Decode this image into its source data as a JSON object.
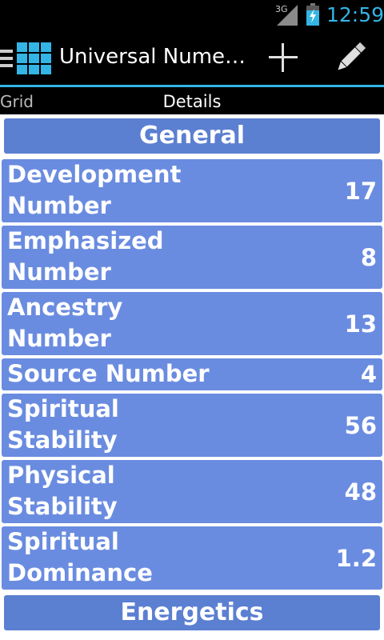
{
  "status_bar": {
    "network_type": "3G",
    "time": "12:59"
  },
  "action_bar": {
    "title": "Universal Nume…",
    "accent_color": "#33b5e5"
  },
  "tabs": {
    "grid_label": "Grid",
    "details_label": "Details"
  },
  "sections": {
    "general": "General",
    "energetics": "Energetics"
  },
  "rows": [
    {
      "label": "Development\nNumber",
      "value": "17"
    },
    {
      "label": "Emphasized\nNumber",
      "value": "8"
    },
    {
      "label": "Ancestry\nNumber",
      "value": "13"
    },
    {
      "label": "Source Number",
      "value": "4"
    },
    {
      "label": "Spiritual\nStability",
      "value": "56"
    },
    {
      "label": "Physical\nStability",
      "value": "48"
    },
    {
      "label": "Spiritual\nDominance",
      "value": "1.2"
    }
  ],
  "colors": {
    "header_bg": "#5b7fd1",
    "row_bg": "#6a8ce0"
  }
}
